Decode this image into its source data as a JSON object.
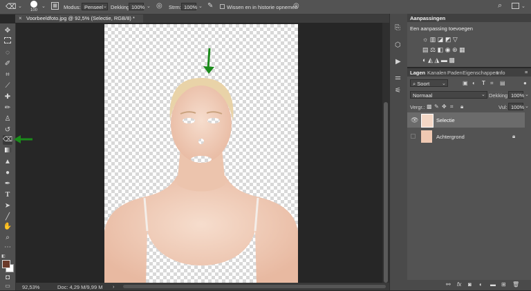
{
  "options_bar": {
    "brush_size": "100",
    "modus_label": "Modus:",
    "modus_value": "Penseel",
    "dekking_label": "Dekking:",
    "dekking_value": "100%",
    "strm_label": "Strm:",
    "strm_value": "100%",
    "history_label": "Wissen en in historie opnemen"
  },
  "document_tab": {
    "title": "Voorbeeldfoto.jpg @ 92,5% (Selectie, RGB/8) *"
  },
  "status_bar": {
    "zoom": "92,53%",
    "doc_info": "Doc: 4,29 M/9,99 M"
  },
  "adjustments_panel": {
    "title": "Aanpassingen",
    "subtitle": "Een aanpassing toevoegen"
  },
  "layers_panel": {
    "tabs": [
      "Lagen",
      "Kanalen",
      "Paden",
      "Eigenschappen",
      "Info"
    ],
    "filter_label": "Soort",
    "blend_mode": "Normaal",
    "opacity_label": "Dekking:",
    "opacity_value": "100%",
    "lock_label": "Vergr.:",
    "fill_label": "Vul:",
    "fill_value": "100%",
    "layers": [
      {
        "name": "Selectie",
        "visible": true,
        "selected": true
      },
      {
        "name": "Achtergrond",
        "visible": false,
        "selected": false,
        "locked": true
      }
    ]
  },
  "colors": {
    "ui_bg": "#535353",
    "canvas_bg": "#262626",
    "annotation_arrow": "#1a8a1a",
    "foreground_color": "#6b3a2a",
    "background_color": "#ffffff"
  }
}
